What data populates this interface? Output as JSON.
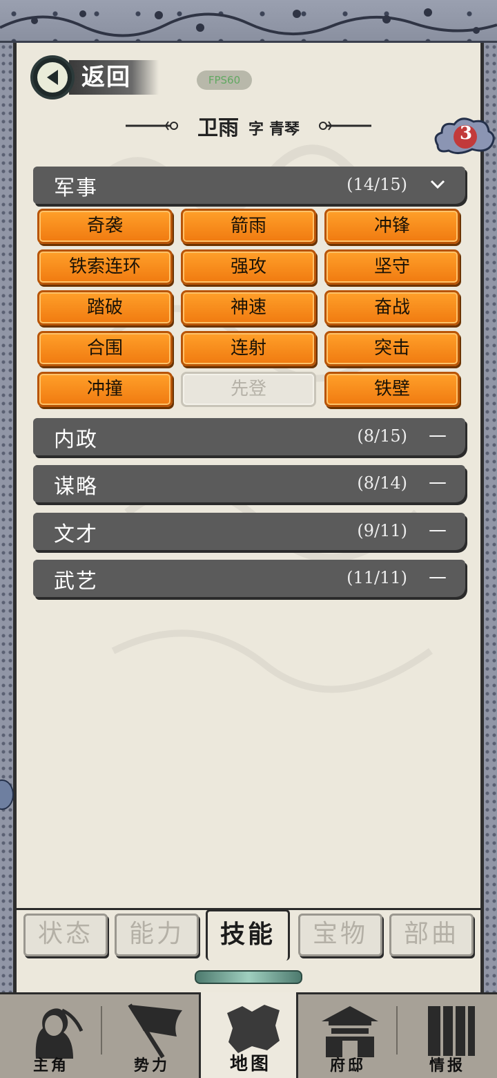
{
  "header": {
    "back_label": "返回",
    "fps": "FPS60",
    "name": "卫雨",
    "zi_label": "字",
    "style_name": "青琴",
    "badge_count": "3"
  },
  "sections": [
    {
      "title": "军事",
      "count": "(14/15)",
      "expanded": true,
      "toggle": "﹀",
      "skills": [
        {
          "label": "奇袭",
          "unlocked": true
        },
        {
          "label": "箭雨",
          "unlocked": true
        },
        {
          "label": "冲锋",
          "unlocked": true
        },
        {
          "label": "铁索连环",
          "unlocked": true
        },
        {
          "label": "强攻",
          "unlocked": true
        },
        {
          "label": "坚守",
          "unlocked": true
        },
        {
          "label": "踏破",
          "unlocked": true
        },
        {
          "label": "神速",
          "unlocked": true
        },
        {
          "label": "奋战",
          "unlocked": true
        },
        {
          "label": "合围",
          "unlocked": true
        },
        {
          "label": "连射",
          "unlocked": true
        },
        {
          "label": "突击",
          "unlocked": true
        },
        {
          "label": "冲撞",
          "unlocked": true
        },
        {
          "label": "先登",
          "unlocked": false
        },
        {
          "label": "铁壁",
          "unlocked": true
        }
      ]
    },
    {
      "title": "内政",
      "count": "(8/15)",
      "expanded": false,
      "toggle": "—"
    },
    {
      "title": "谋略",
      "count": "(8/14)",
      "expanded": false,
      "toggle": "—"
    },
    {
      "title": "文才",
      "count": "(9/11)",
      "expanded": false,
      "toggle": "—"
    },
    {
      "title": "武艺",
      "count": "(11/11)",
      "expanded": false,
      "toggle": "—"
    }
  ],
  "sub_tabs": [
    {
      "label": "状态",
      "active": false
    },
    {
      "label": "能力",
      "active": false
    },
    {
      "label": "技能",
      "active": true
    },
    {
      "label": "宝物",
      "active": false
    },
    {
      "label": "部曲",
      "active": false
    }
  ],
  "bottom_nav": [
    {
      "label": "主角",
      "icon": "warrior-icon",
      "active": false
    },
    {
      "label": "势力",
      "icon": "flag-icon",
      "active": false
    },
    {
      "label": "地图",
      "icon": "map-icon",
      "active": true
    },
    {
      "label": "府邸",
      "icon": "mansion-icon",
      "active": false
    },
    {
      "label": "情报",
      "icon": "scroll-icon",
      "active": false
    }
  ],
  "colors": {
    "skill_orange": "#f78a1a",
    "section_bar": "#5b5b5b",
    "paper": "#ece8dc",
    "frame": "#8d93a3",
    "badge_red": "#c23a3a"
  }
}
